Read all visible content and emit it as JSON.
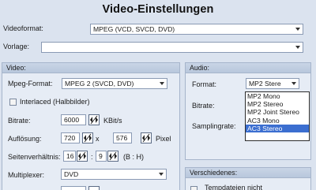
{
  "window": {
    "title": "Video-Einstellungen"
  },
  "top": {
    "videoformat_label": "Videoformat:",
    "videoformat_value": "MPEG (VCD, SVCD, DVD)",
    "vorlage_label": "Vorlage:",
    "vorlage_value": ""
  },
  "video": {
    "header": "Video:",
    "mpeg_label": "Mpeg-Format:",
    "mpeg_value": "MPEG 2 (SVCD, DVD)",
    "interlaced_label": "Interlaced (Halbbilder)",
    "interlaced_checked": false,
    "bitrate_label": "Bitrate:",
    "bitrate_value": "6000",
    "bitrate_unit": "KBit/s",
    "aufloesung_label": "Auflösung:",
    "width_value": "720",
    "times": "x",
    "height_value": "576",
    "pixel_unit": "Pixel",
    "seiten_label": "Seitenverhältnis:",
    "aspect_w": "16",
    "colon": ":",
    "aspect_h": "9",
    "aspect_hint": "(B : H)",
    "multiplexer_label": "Multiplexer:",
    "multiplexer_value": "DVD"
  },
  "audio": {
    "header": "Audio:",
    "format_label": "Format:",
    "format_value": "MP2 Stere",
    "bitrate_label": "Bitrate:",
    "samplingrate_label": "Samplingrate:",
    "options": [
      "MP2 Mono",
      "MP2 Stereo",
      "MP2 Joint Stereo",
      "AC3 Mono",
      "AC3 Stereo"
    ],
    "selected_index": 4
  },
  "verschiedenes": {
    "header": "Verschiedenes:",
    "temp_label": "Tempdateien nicht"
  }
}
